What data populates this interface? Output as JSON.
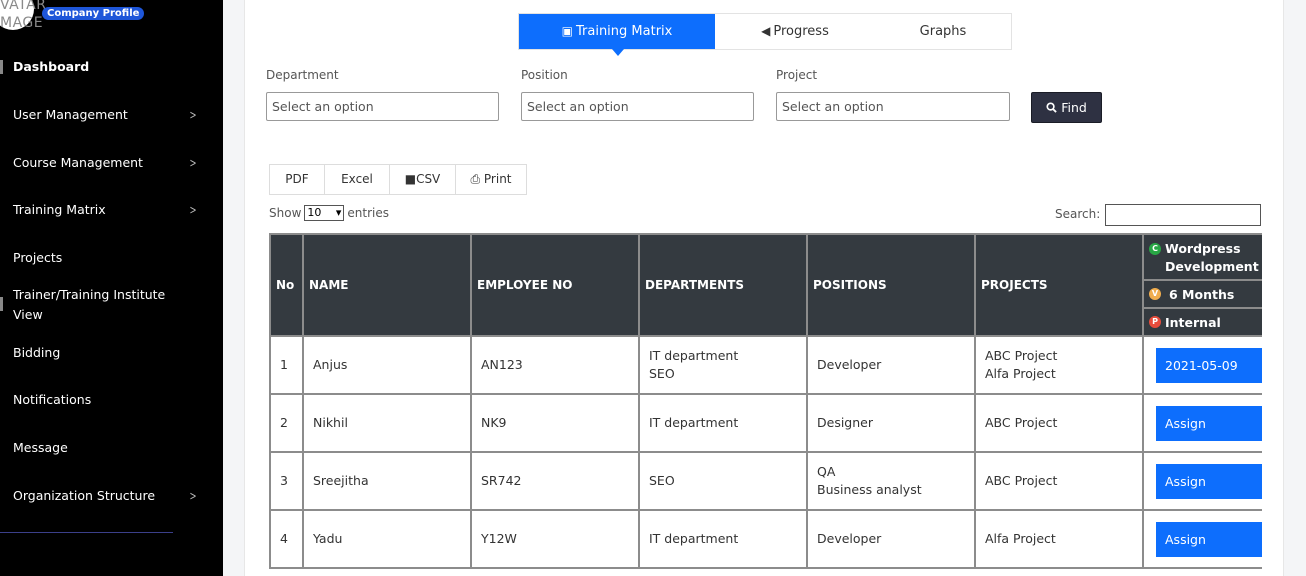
{
  "sidebar": {
    "avatar_alt": "VATAR\nMAGE",
    "company_profile": "Company Profile",
    "items": [
      {
        "label": "Dashboard",
        "chevron": false
      },
      {
        "label": "User Management",
        "chevron": true
      },
      {
        "label": "Course Management",
        "chevron": true
      },
      {
        "label": "Training Matrix",
        "chevron": true
      },
      {
        "label": "Projects",
        "chevron": false
      },
      {
        "label": "Trainer/Training Institute View",
        "chevron": false
      },
      {
        "label": "Bidding",
        "chevron": false
      },
      {
        "label": "Notifications",
        "chevron": false
      },
      {
        "label": "Message",
        "chevron": false
      },
      {
        "label": "Organization Structure",
        "chevron": true
      }
    ]
  },
  "tabs": [
    {
      "label": "Training Matrix",
      "icon": "cube-icon",
      "active": true
    },
    {
      "label": "Progress",
      "icon": "megaphone-icon",
      "active": false
    },
    {
      "label": "Graphs",
      "icon": "",
      "active": false
    }
  ],
  "filters": {
    "department": {
      "label": "Department",
      "placeholder": "Select an option"
    },
    "position": {
      "label": "Position",
      "placeholder": "Select an option"
    },
    "project": {
      "label": "Project",
      "placeholder": "Select an option"
    },
    "find_label": "Find"
  },
  "export_buttons": {
    "pdf": "PDF",
    "excel": "Excel",
    "csv": "CSV",
    "print": "Print"
  },
  "entries": {
    "show_label": "Show",
    "value": "10",
    "entries_label": "entries"
  },
  "search_label": "Search:",
  "table": {
    "headers": {
      "no": "No",
      "name": "NAME",
      "employee_no": "EMPLOYEE NO",
      "departments": "DEPARTMENTS",
      "positions": "POSITIONS",
      "projects": "PROJECTS"
    },
    "course": {
      "name": "Wordpress Development",
      "name_badge": "C",
      "duration": "6 Months",
      "duration_badge": "V",
      "type": "Internal",
      "type_badge": "P"
    },
    "rows": [
      {
        "no": "1",
        "name": "Anjus",
        "employee_no": "AN123",
        "departments": [
          "IT department",
          "SEO"
        ],
        "positions": [
          "Developer"
        ],
        "projects": [
          "ABC Project",
          "Alfa Project"
        ],
        "course_status": "2021-05-09"
      },
      {
        "no": "2",
        "name": "Nikhil",
        "employee_no": "NK9",
        "departments": [
          "IT department"
        ],
        "positions": [
          "Designer"
        ],
        "projects": [
          "ABC Project"
        ],
        "course_status": "Assign"
      },
      {
        "no": "3",
        "name": "Sreejitha",
        "employee_no": "SR742",
        "departments": [
          "SEO"
        ],
        "positions": [
          "QA",
          "Business analyst"
        ],
        "projects": [
          "ABC Project"
        ],
        "course_status": "Assign"
      },
      {
        "no": "4",
        "name": "Yadu",
        "employee_no": "Y12W",
        "departments": [
          "IT department"
        ],
        "positions": [
          "Developer"
        ],
        "projects": [
          "Alfa Project"
        ],
        "course_status": "Assign"
      }
    ]
  },
  "colors": {
    "sidebar_bg": "#000000",
    "accent": "#0d6efd",
    "header_bg": "#343a40",
    "find_bg": "#2e3142",
    "badge_c": "#28a745",
    "badge_v": "#f0ad4e",
    "badge_p": "#e74c3c"
  }
}
